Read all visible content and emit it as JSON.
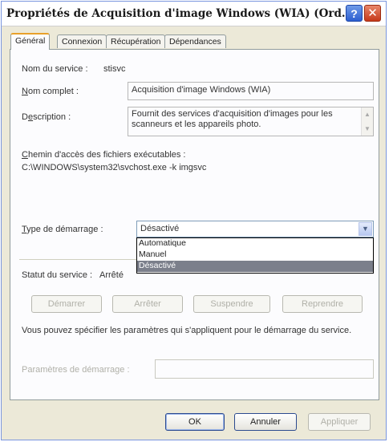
{
  "window": {
    "title": "Propriétés de Acquisition d'image Windows (WIA) (Ord...",
    "help_glyph": "?",
    "close_glyph": "✕"
  },
  "tabs": [
    {
      "label": "Général"
    },
    {
      "label": "Connexion"
    },
    {
      "label": "Récupération"
    },
    {
      "label": "Dépendances"
    }
  ],
  "general": {
    "service_name_label": "Nom du service :",
    "service_name_value": "stisvc",
    "display_name_label": "Nom complet :",
    "display_name_value": "Acquisition d'image Windows (WIA)",
    "description_label": "Description :",
    "description_value": "Fournit des services d'acquisition d'images pour les scanneurs et les appareils photo.",
    "path_label": "Chemin d'accès des fichiers exécutables :",
    "path_value": "C:\\WINDOWS\\system32\\svchost.exe -k imgsvc",
    "startup_type_label": "Type de démarrage :",
    "startup_type_value": "Désactivé",
    "startup_options": [
      "Automatique",
      "Manuel",
      "Désactivé"
    ],
    "service_status_label": "Statut du service :",
    "service_status_value": "Arrêté",
    "start_button": "Démarrer",
    "stop_button": "Arrêter",
    "pause_button": "Suspendre",
    "resume_button": "Reprendre",
    "start_params_help": "Vous pouvez spécifier les paramètres qui s'appliquent pour le démarrage du service.",
    "start_params_label": "Paramètres de démarrage :",
    "start_params_value": ""
  },
  "footer": {
    "ok_button": "OK",
    "cancel_button": "Annuler",
    "apply_button": "Appliquer"
  }
}
